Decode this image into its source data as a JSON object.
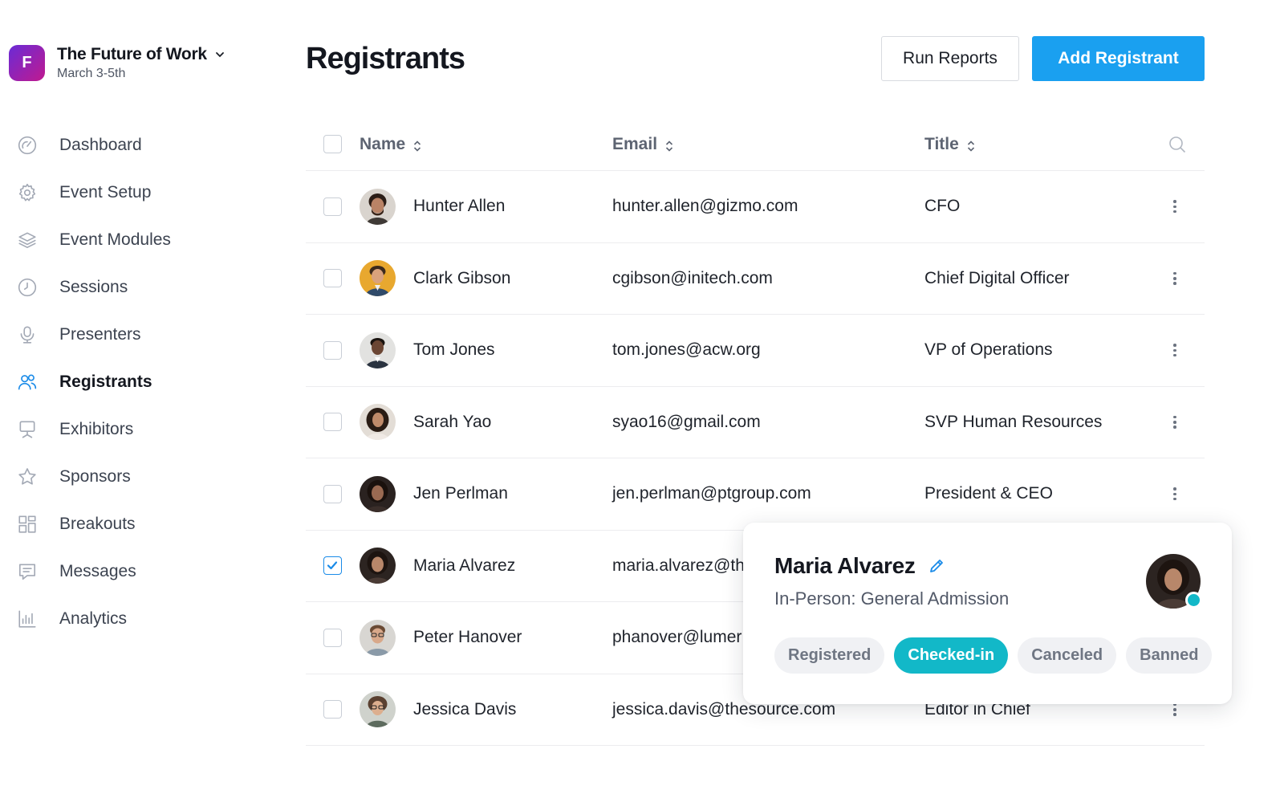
{
  "event": {
    "logo_letter": "F",
    "title": "The Future of Work",
    "dates": "March 3-5th",
    "brand_gradient": [
      "#6a2bd6",
      "#c01a8f"
    ]
  },
  "sidebar": {
    "items": [
      {
        "label": "Dashboard",
        "icon": "gauge-icon"
      },
      {
        "label": "Event Setup",
        "icon": "gear-icon"
      },
      {
        "label": "Event Modules",
        "icon": "layers-icon"
      },
      {
        "label": "Sessions",
        "icon": "clock-icon"
      },
      {
        "label": "Presenters",
        "icon": "microphone-icon"
      },
      {
        "label": "Registrants",
        "icon": "users-icon",
        "active": true
      },
      {
        "label": "Exhibitors",
        "icon": "booth-icon"
      },
      {
        "label": "Sponsors",
        "icon": "star-icon"
      },
      {
        "label": "Breakouts",
        "icon": "grid-icon"
      },
      {
        "label": "Messages",
        "icon": "message-icon"
      },
      {
        "label": "Analytics",
        "icon": "bar-chart-icon"
      }
    ]
  },
  "header": {
    "title": "Registrants",
    "run_reports_label": "Run Reports",
    "add_registrant_label": "Add Registrant"
  },
  "table": {
    "columns": {
      "name": "Name",
      "email": "Email",
      "title": "Title"
    },
    "rows": [
      {
        "name": "Hunter Allen",
        "email": "hunter.allen@gizmo.com",
        "title": "CFO",
        "checked": false
      },
      {
        "name": "Clark Gibson",
        "email": "cgibson@initech.com",
        "title": "Chief Digital Officer",
        "checked": false
      },
      {
        "name": "Tom Jones",
        "email": "tom.jones@acw.org",
        "title": "VP of Operations",
        "checked": false
      },
      {
        "name": "Sarah Yao",
        "email": "syao16@gmail.com",
        "title": "SVP Human Resources",
        "checked": false
      },
      {
        "name": "Jen Perlman",
        "email": "jen.perlman@ptgroup.com",
        "title": "President & CEO",
        "checked": false
      },
      {
        "name": "Maria Alvarez",
        "email": "maria.alvarez@th",
        "title": "",
        "checked": true
      },
      {
        "name": "Peter Hanover",
        "email": "phanover@lumer",
        "title": "",
        "checked": false
      },
      {
        "name": "Jessica Davis",
        "email": "jessica.davis@thesource.com",
        "title": "Editor in Chief",
        "checked": false
      }
    ]
  },
  "popover": {
    "name": "Maria Alvarez",
    "ticket_type": "In-Person: General Admission",
    "statuses": [
      "Registered",
      "Checked-in",
      "Canceled",
      "Banned"
    ],
    "active_status": "Checked-in"
  },
  "colors": {
    "primary": "#1aa0f0",
    "accent_blue": "#1a8be8",
    "status_active": "#12b8c8"
  }
}
